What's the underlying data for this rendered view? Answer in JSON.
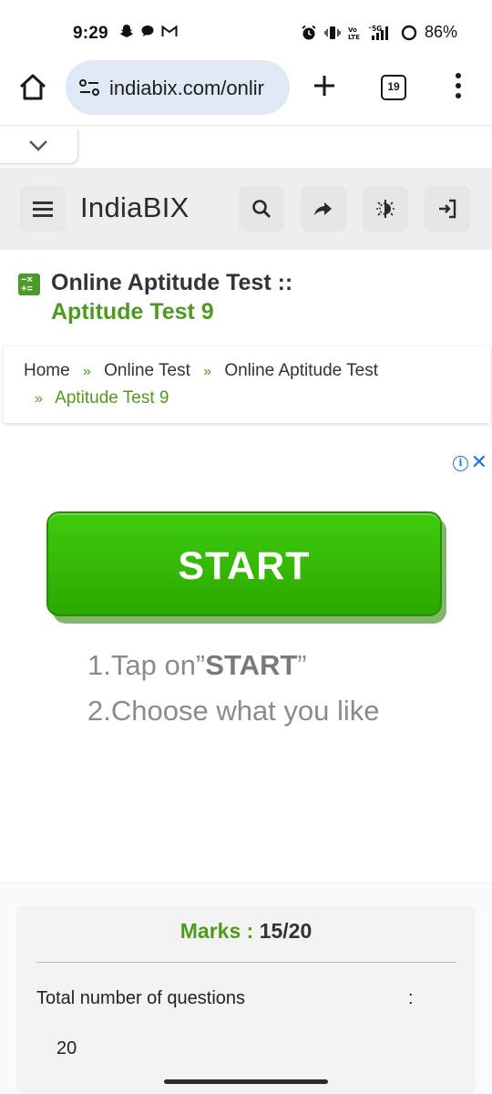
{
  "status_bar": {
    "time": "9:29",
    "battery": "86%",
    "tab_count": "19"
  },
  "browser": {
    "url": "indiabix.com/onlir"
  },
  "site": {
    "logo_text": "IndiaBIX"
  },
  "page": {
    "title": "Online Aptitude Test ::",
    "subtitle": "Aptitude Test 9"
  },
  "breadcrumb": {
    "items": [
      "Home",
      "Online Test",
      "Online Aptitude Test",
      "Aptitude Test 9"
    ],
    "separator": "»"
  },
  "ad": {
    "button_label": "START",
    "step1_prefix": "1.Tap on”",
    "step1_bold": "START",
    "step1_suffix": "”",
    "step2": "2.Choose what you like",
    "info_glyph": "i",
    "close_glyph": "✕"
  },
  "results": {
    "marks_label": "Marks :",
    "marks_value": "15/20",
    "total_label": "Total number of questions",
    "colon": ":",
    "total_value": "20"
  },
  "colors": {
    "brand_green": "#4e9a1e",
    "start_green": "#2da800",
    "url_pill": "#dfe8f5",
    "ad_link_blue": "#1a73e8"
  }
}
